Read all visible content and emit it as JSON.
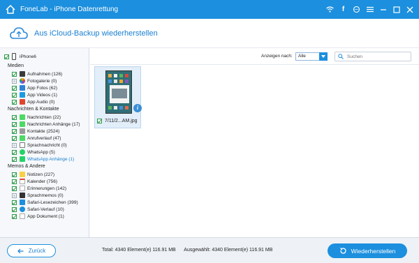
{
  "app": {
    "title": "FoneLab - iPhone Datenrettung"
  },
  "header": {
    "title": "Aus iCloud-Backup wiederherstellen"
  },
  "sidebar": {
    "device": "iPhone6",
    "groups": [
      {
        "label": "Medien",
        "items": [
          {
            "label": "Aufnahmen (126)",
            "checked": true
          },
          {
            "label": "Fotogalerie (0)",
            "checked": false
          },
          {
            "label": "App Fotos (62)",
            "checked": true
          },
          {
            "label": "App Videos (1)",
            "checked": true
          },
          {
            "label": "App Audio (0)",
            "checked": false
          }
        ]
      },
      {
        "label": "Nachrichten & Kontakte",
        "items": [
          {
            "label": "Nachrichten (22)",
            "checked": true
          },
          {
            "label": "Nachrichten Anhänge (17)",
            "checked": true
          },
          {
            "label": "Kontakte (2524)",
            "checked": true
          },
          {
            "label": "Anrufverlauf (47)",
            "checked": true
          },
          {
            "label": "Sprachnachricht (0)",
            "checked": false
          },
          {
            "label": "WhatsApp (5)",
            "checked": true
          },
          {
            "label": "WhatsApp Anhänge (1)",
            "checked": true,
            "selected": true
          }
        ]
      },
      {
        "label": "Memos & Andere",
        "items": [
          {
            "label": "Notizen (227)",
            "checked": true
          },
          {
            "label": "Kalender (756)",
            "checked": true
          },
          {
            "label": "Erinnerungen (142)",
            "checked": true
          },
          {
            "label": "Sprachmemos (0)",
            "checked": false
          },
          {
            "label": "Safari-Lesezeichen (399)",
            "checked": true
          },
          {
            "label": "Safari-Verlauf (10)",
            "checked": true
          },
          {
            "label": "App Dokument (1)",
            "checked": true
          }
        ]
      }
    ]
  },
  "filter": {
    "label": "Anzeigen nach:",
    "selected": "Alle",
    "search_placeholder": "Suchen"
  },
  "files": [
    {
      "name": "7/11/2...AM.jpg",
      "checked": true
    }
  ],
  "footer": {
    "back_label": "Zurück",
    "total": "Total: 4340 Element(e) 116.91 MB",
    "selected": "Ausgewählt: 4340 Element(e) 116.91 MB",
    "restore_label": "Wiederherstellen"
  }
}
